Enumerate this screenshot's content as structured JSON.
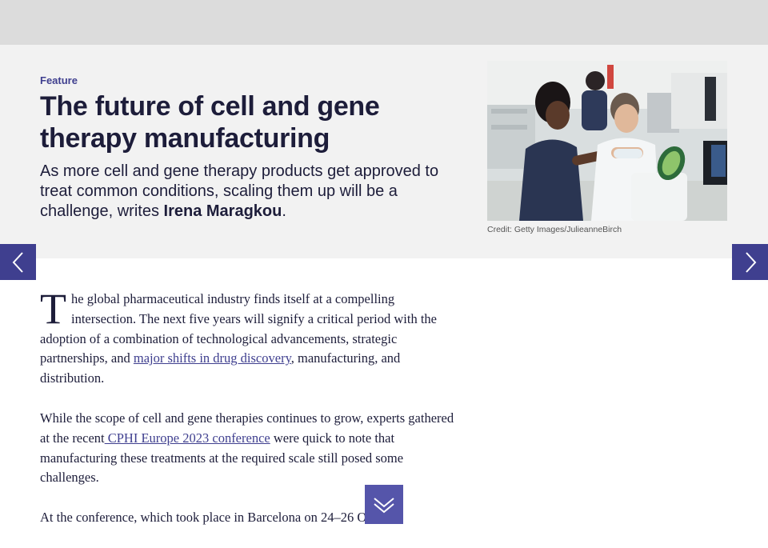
{
  "hero": {
    "eyebrow": "Feature",
    "title": "The future of cell and gene therapy manufacturing",
    "standfirst_pre": "As more cell and gene therapy products get approved to treat common conditions, scaling them up will be a challenge, writes ",
    "author": "Irena Maragkou",
    "standfirst_post": ".",
    "image_credit": "Credit: Getty Images/JulieanneBirch"
  },
  "nav": {
    "prev_icon": "chevron-left-icon",
    "next_icon": "chevron-right-icon",
    "scroll_icon": "double-chevron-down-icon"
  },
  "article": {
    "p1_dropcap": "T",
    "p1_text_a": "he global pharmaceutical industry finds itself at a compelling intersection. The next five years will signify a critical period with the adoption of a combination of technological advancements, strategic partnerships, and ",
    "p1_link": "major shifts in drug discovery",
    "p1_text_b": ", manufacturing, and distribution.",
    "p2_text_a": "While the scope of cell and gene therapies continues to grow, experts gathered at the recent",
    "p2_link": " CPHI Europe 2023 conference",
    "p2_text_b": " were quick to note that manufacturing these treatments at the required scale still posed some challenges.",
    "p3_text": "At the conference, which took place in Barcelona on 24–26 October,"
  },
  "colors": {
    "accent": "#3f3f8f",
    "hero_bg": "#f2f2f2",
    "topbar_bg": "#dcdcdc",
    "text": "#1d1d3a"
  }
}
